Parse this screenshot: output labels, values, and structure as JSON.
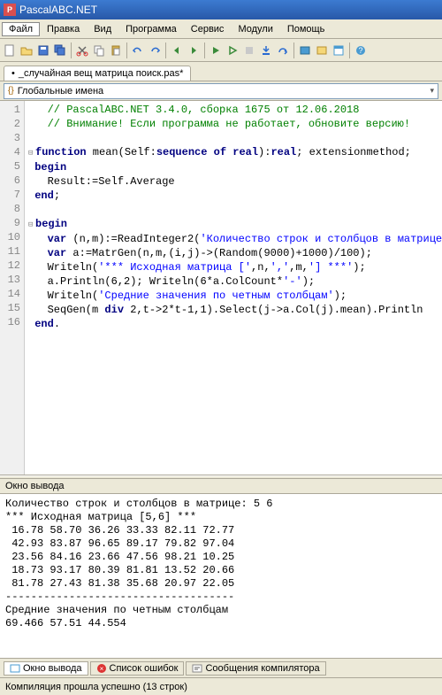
{
  "app_title": "PascalABC.NET",
  "menubar": [
    "Файл",
    "Правка",
    "Вид",
    "Программа",
    "Сервис",
    "Модули",
    "Помощь"
  ],
  "tab": {
    "label": "_случайная вещ матрица поиск.pas*"
  },
  "dropdown_label": "Глобальные имена",
  "code": {
    "l1": "   // PascalABC.NET 3.4.0, сборка 1675 от 12.06.2018",
    "l2": "   // Внимание! Если программа не работает, обновите версию!",
    "l3": " ",
    "l4a": "function",
    "l4b": " mean(Self:",
    "l4c": "sequence of real",
    "l4d": "):",
    "l4e": "real",
    "l4f": "; extensionmethod;",
    "l5": "begin",
    "l6a": "   Result:=Self.Average",
    "l7": "end",
    "l8": " ",
    "l9": "begin",
    "l10a": "   var",
    "l10b": " (n,m):=ReadInteger2(",
    "l10c": "'Количество строк и столбцов в матрице:'",
    "l10d": ");",
    "l11a": "   var",
    "l11b": " a:=MatrGen(n,m,(i,j)->(Random(",
    "l11c": "9000",
    "l11d": ")+",
    "l11e": "1000",
    "l11f": ")/",
    "l11g": "100",
    "l11h": ");",
    "l12a": "   Writeln(",
    "l12b": "'*** Исходная матрица ['",
    "l12c": ",n,",
    "l12d": "','",
    "l12e": ",m,",
    "l12f": "'] ***'",
    "l12g": ");",
    "l13a": "   a.Println(",
    "l13b": "6",
    "l13c": ",",
    "l13d": "2",
    "l13e": "); Writeln(",
    "l13f": "6",
    "l13g": "*a.ColCount*",
    "l13h": "'-'",
    "l13i": ");",
    "l14a": "   Writeln(",
    "l14b": "'Средние значения по четным столбцам'",
    "l14c": ");",
    "l15a": "   SeqGen(m ",
    "l15b": "div",
    "l15c": " ",
    "l15d": "2",
    "l15e": ",t->",
    "l15f": "2",
    "l15g": "*t-",
    "l15h": "1",
    "l15i": ",",
    "l15j": "1",
    "l15k": ").Select(j->a.Col(j).mean).Println",
    "l16": "end"
  },
  "gutter_lines": [
    "1",
    "2",
    "3",
    "4",
    "5",
    "6",
    "7",
    "8",
    "9",
    "10",
    "11",
    "12",
    "13",
    "14",
    "15",
    "16"
  ],
  "output_title": "Окно вывода",
  "output_text": "Количество строк и столбцов в матрице: 5 6\n*** Исходная матрица [5,6] ***\n 16.78 58.70 36.26 33.33 82.11 72.77\n 42.93 83.87 96.65 89.17 79.82 97.04\n 23.56 84.16 23.66 47.56 98.21 10.25\n 18.73 93.17 80.39 81.81 13.52 20.66\n 81.78 27.43 81.38 35.68 20.97 22.05\n------------------------------------\nСредние значения по четным столбцам\n69.466 57.51 44.554",
  "bottom_tabs": {
    "t1": "Окно вывода",
    "t2": "Список ошибок",
    "t3": "Сообщения компилятора"
  },
  "status": "Компиляция прошла успешно (13 строк)"
}
